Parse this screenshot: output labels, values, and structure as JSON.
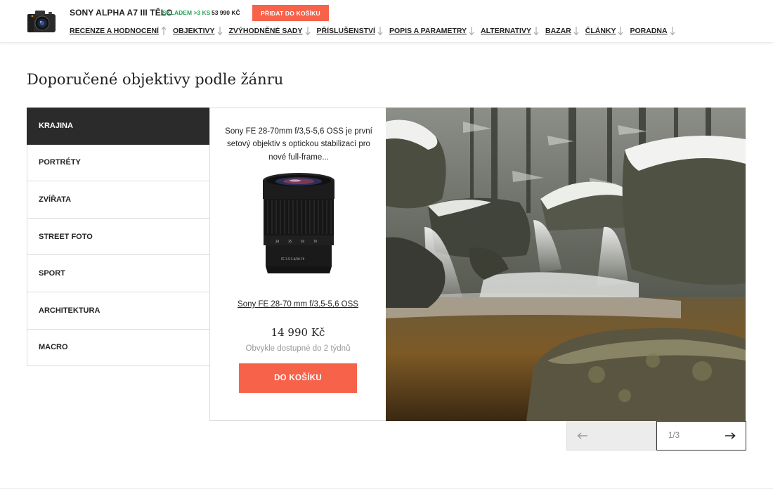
{
  "header": {
    "product_name": "SONY ALPHA A7 III TĚLO",
    "stock": "SKLADEM >3 KS",
    "price": "53 990 KČ",
    "add_to_cart": "PŘIDAT DO KOŠÍKU",
    "nav": [
      {
        "label": "RECENZE A HODNOCENÍ",
        "icon": "arrow-up-icon"
      },
      {
        "label": "OBJEKTIVY",
        "icon": "arrow-down-icon"
      },
      {
        "label": "ZVÝHODNĚNÉ SADY",
        "icon": "arrow-down-icon"
      },
      {
        "label": "PŘÍSLUŠENSTVÍ",
        "icon": "arrow-down-icon"
      },
      {
        "label": "POPIS A PARAMETRY",
        "icon": "arrow-down-icon"
      },
      {
        "label": "ALTERNATIVY",
        "icon": "arrow-down-icon"
      },
      {
        "label": "BAZAR",
        "icon": "arrow-down-icon"
      },
      {
        "label": "ČLÁNKY",
        "icon": "arrow-down-icon"
      },
      {
        "label": "PORADNA",
        "icon": "arrow-down-icon"
      }
    ]
  },
  "section": {
    "title": "Doporučené objektivy podle žánru",
    "genres": [
      "KRAJINA",
      "PORTRÉTY",
      "ZVÍŘATA",
      "STREET FOTO",
      "SPORT",
      "ARCHITEKTURA",
      "MACRO"
    ],
    "active_genre": "KRAJINA",
    "product": {
      "description": "Sony FE 28-70mm f/3,5-5,6 OSS je první setový objektiv s optickou stabilizací pro nové full-frame...",
      "name": "Sony FE 28-70 mm f/3,5-5,6 OSS",
      "price": "14 990 Kč",
      "availability": "Obvykle dostupné do 2 týdnů",
      "cart_button": "DO KOŠÍKU"
    },
    "pager": {
      "counter": "1/3",
      "prev_icon": "arrow-left-icon",
      "next_icon": "arrow-right-icon"
    }
  },
  "colors": {
    "accent": "#f7624a",
    "stock_green": "#2aa45a",
    "active_tab": "#2b2b2b"
  }
}
